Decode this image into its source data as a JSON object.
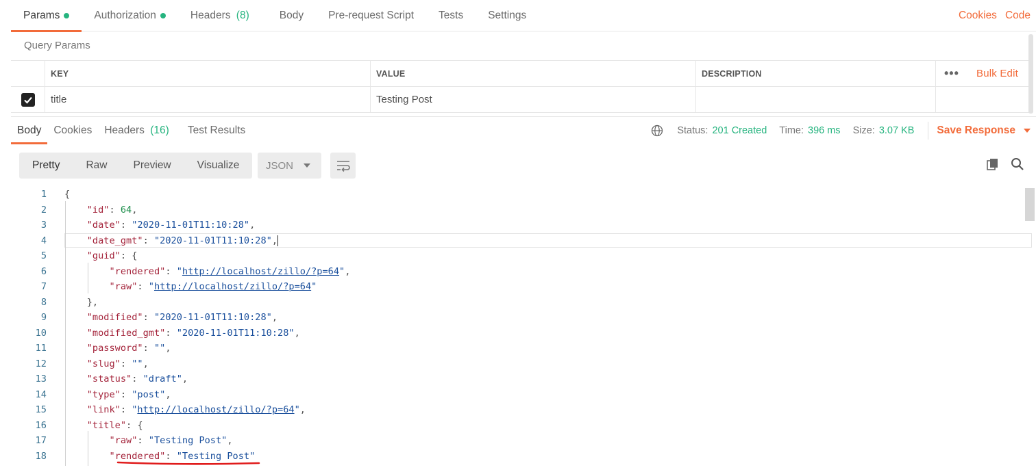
{
  "request_tabs": [
    {
      "label": "Params",
      "dot": true
    },
    {
      "label": "Authorization",
      "dot": true
    },
    {
      "label": "Headers",
      "count": "(8)"
    },
    {
      "label": "Body"
    },
    {
      "label": "Pre-request Script"
    },
    {
      "label": "Tests"
    },
    {
      "label": "Settings"
    }
  ],
  "request_right": {
    "cookies": "Cookies",
    "code": "Code"
  },
  "query_params": {
    "title": "Query Params",
    "headers": {
      "key": "KEY",
      "value": "VALUE",
      "description": "DESCRIPTION",
      "more": "•••",
      "bulk_edit": "Bulk Edit"
    },
    "rows": [
      {
        "checked": true,
        "key": "title",
        "value": "Testing Post",
        "description": ""
      }
    ]
  },
  "response_tabs": [
    {
      "label": "Body"
    },
    {
      "label": "Cookies"
    },
    {
      "label": "Headers",
      "count": "(16)"
    },
    {
      "label": "Test Results"
    }
  ],
  "response_meta": {
    "status_label": "Status:",
    "status_value": "201 Created",
    "time_label": "Time:",
    "time_value": "396 ms",
    "size_label": "Size:",
    "size_value": "3.07 KB",
    "save_label": "Save Response"
  },
  "view_modes": [
    "Pretty",
    "Raw",
    "Preview",
    "Visualize"
  ],
  "format": "JSON",
  "code_lines": [
    "1",
    "2",
    "3",
    "4",
    "5",
    "6",
    "7",
    "8",
    "9",
    "10",
    "11",
    "12",
    "13",
    "14",
    "15",
    "16",
    "17",
    "18"
  ],
  "json": {
    "id": "64",
    "date": "\"2020-11-01T11:10:28\"",
    "date_gmt": "\"2020-11-01T11:10:28\"",
    "guid_rendered": "http://localhost/zillo/?p=64",
    "guid_raw": "http://localhost/zillo/?p=64",
    "modified": "\"2020-11-01T11:10:28\"",
    "modified_gmt": "\"2020-11-01T11:10:28\"",
    "password": "\"\"",
    "slug": "\"\"",
    "status": "\"draft\"",
    "type": "\"post\"",
    "link": "http://localhost/zillo/?p=64",
    "title_raw": "\"Testing Post\"",
    "title_rendered": "\"Testing Post\""
  },
  "colors": {
    "accent": "#f26b3a",
    "success": "#26b47f",
    "key": "#a4243b",
    "string": "#1a4f9c"
  }
}
